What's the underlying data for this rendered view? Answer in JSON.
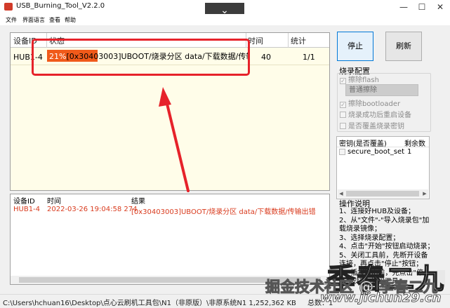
{
  "window": {
    "title": "USB_Burning_Tool_V2.2.0",
    "collapse_glyph": "⌄",
    "min_glyph": "—",
    "max_glyph": "☐",
    "close_glyph": "✕"
  },
  "menu": {
    "items": [
      "文件",
      "界面语言",
      "查看",
      "帮助"
    ]
  },
  "grid": {
    "columns": [
      "设备ID",
      "状态",
      "时间",
      "统计"
    ],
    "rows": [
      {
        "device_id": "HUB1-4",
        "status_percent": "21%",
        "status_detail": "[0x30403003]UBOOT/烧录分区 data/下载数据/传输出错",
        "progress": 0.21,
        "time": "40",
        "stats": "1/1"
      }
    ]
  },
  "buttons": {
    "stop": "停止",
    "refresh": "刷新"
  },
  "burn_config": {
    "label": "烧录配置",
    "erase_flash": "擦除flash",
    "erase_mode": "普通擦除",
    "erase_bootloader": "擦除bootloader",
    "reset_after": "烧录成功后重启设备",
    "overwrite_key": "是否覆盖烧录密钥",
    "checked_mark": "✓"
  },
  "key_table": {
    "columns": [
      "密钥(是否覆盖)",
      "剩余数"
    ],
    "rows": [
      {
        "name": "secure_boot_set",
        "remaining": "1"
      }
    ],
    "left_arrow": "◀",
    "right_arrow": "▶"
  },
  "help": {
    "label": "操作说明",
    "lines": [
      "1、连接好HUB及设备；",
      "2、从\"文件\"-\"导入烧录包\"加载烧录镜像；",
      "3、选择烧录配置；",
      "4、点击\"开始\"按钮启动烧录；",
      "5、关闭工具前，先断开设备连接，再点击\"停止\"按钮；",
      "6、插拔hub前，先点击\"停止\"按钮，关闭工具。"
    ]
  },
  "log": {
    "columns": [
      "设备ID",
      "时间",
      "结果"
    ],
    "rows": [
      {
        "device_id": "HUB1-4",
        "time": "2022-03-26 19:04:58 274",
        "result": "[0x30403003]UBOOT/烧录分区 data/下载数据/传输出错"
      }
    ]
  },
  "statusbar": {
    "path": "C:\\Users\\hchuan16\\Desktop\\点心云刷机工具包\\N1（非原版）\\非原系统N1 1,252,362 KB",
    "total": "总数：1"
  },
  "watermark": {
    "line1": "季春二九",
    "line2": "掘金技术社区 @ 季春二九",
    "line3": "www.jichun29.cn"
  },
  "colors": {
    "progress": "#f05a1a",
    "highlight_box": "#e6222a",
    "log_text": "#d93b1e",
    "row_bg": "#fffde9"
  }
}
